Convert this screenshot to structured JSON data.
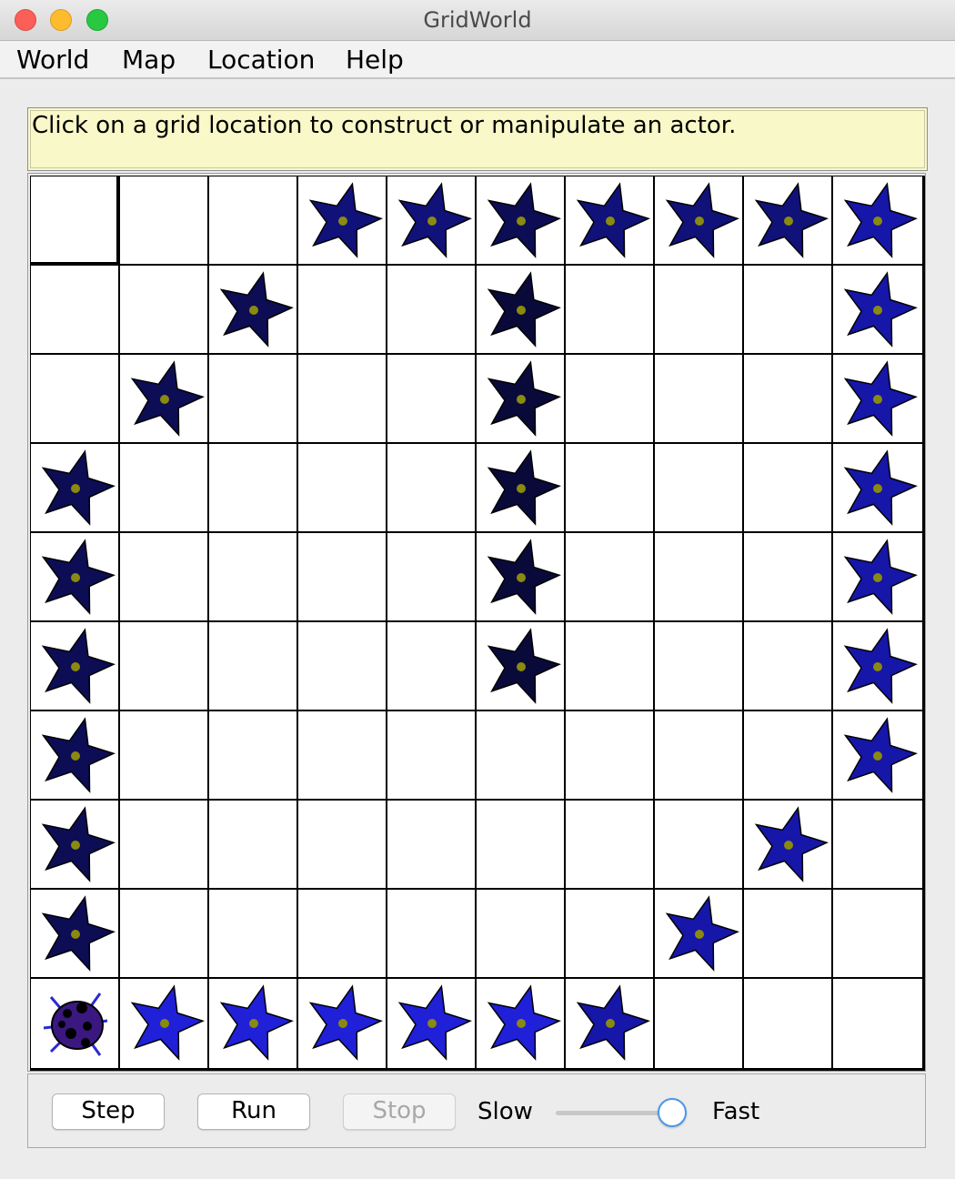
{
  "window": {
    "title": "GridWorld"
  },
  "menubar": {
    "items": [
      "World",
      "Map",
      "Location",
      "Help"
    ]
  },
  "message": "Click on a grid location to construct or manipulate an actor.",
  "grid": {
    "rows": 10,
    "cols": 10,
    "selected": [
      0,
      0
    ],
    "flower_colors": [
      "#0a0a3a",
      "#0d0d55",
      "#11117a",
      "#1616a8",
      "#2020d8"
    ],
    "bug": {
      "row": 9,
      "col": 0,
      "color": "#3a1880",
      "icon": "bug-icon"
    },
    "cells": [
      [
        null,
        null,
        null,
        2,
        2,
        1,
        2,
        2,
        2,
        3
      ],
      [
        null,
        null,
        1,
        null,
        null,
        0,
        null,
        null,
        null,
        3
      ],
      [
        null,
        1,
        null,
        null,
        null,
        0,
        null,
        null,
        null,
        3
      ],
      [
        1,
        null,
        null,
        null,
        null,
        0,
        null,
        null,
        null,
        3
      ],
      [
        1,
        null,
        null,
        null,
        null,
        0,
        null,
        null,
        null,
        3
      ],
      [
        1,
        null,
        null,
        null,
        null,
        0,
        null,
        null,
        null,
        3
      ],
      [
        1,
        null,
        null,
        null,
        null,
        null,
        null,
        null,
        null,
        3
      ],
      [
        1,
        null,
        null,
        null,
        null,
        null,
        null,
        null,
        3,
        null
      ],
      [
        1,
        null,
        null,
        null,
        null,
        null,
        null,
        3,
        null,
        null
      ],
      [
        "bug",
        4,
        4,
        4,
        4,
        4,
        3,
        null,
        null,
        null
      ]
    ]
  },
  "controls": {
    "step": "Step",
    "run": "Run",
    "stop": "Stop",
    "slow": "Slow",
    "fast": "Fast",
    "speed_fraction": 0.9
  }
}
